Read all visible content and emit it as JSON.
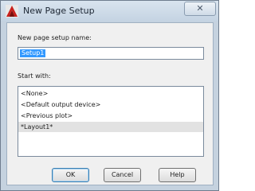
{
  "window": {
    "title": "New Page Setup",
    "close_glyph": "✕"
  },
  "form": {
    "name_label": "New page setup name:",
    "name_value": "Setup1",
    "start_with_label": "Start with:"
  },
  "start_with_list": {
    "items": [
      "<None>",
      "<Default output device>",
      "<Previous plot>",
      "*Layout1*"
    ],
    "selected_index": 3
  },
  "buttons": {
    "ok": "OK",
    "cancel": "Cancel",
    "help": "Help"
  },
  "colors": {
    "selection_highlight": "#3399ff",
    "app_icon_red": "#c8201c"
  },
  "icons": {
    "app": "autocad-logo-icon",
    "close": "close-icon"
  }
}
